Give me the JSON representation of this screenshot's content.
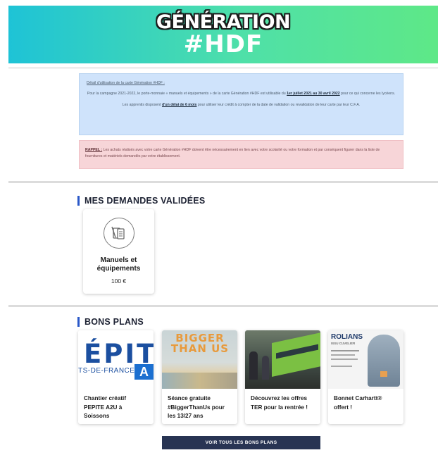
{
  "header": {
    "logo_line1": "GÉNÉRATION",
    "logo_line2": "#HDF",
    "gradient": [
      "#1ec3d6",
      "#5ee887"
    ]
  },
  "info": {
    "title": "Détail d'utilisation de la carte Génération #HDF :",
    "p1_prefix": "Pour la campagne 2021-2022, le porte-monnaie « manuels et équipements » de la carte Génération #HDF est utilisable du",
    "p1_dates": "1er juillet 2021 au 30 avril 2022",
    "p1_suffix": "pour ce qui concerne les lycéens.",
    "p2_prefix": "Les apprentis disposent",
    "p2_delay": "d'un délai de 6 mois",
    "p2_suffix": "pour utiliser leur crédit à compter de la date de validation ou revalidation de leur carte par leur C.F.A."
  },
  "warning": {
    "label": "RAPPEL :",
    "text": "Les achats réalisés avec votre carte Génération #HDF doivent être nécessairement en lien avec votre scolarité ou votre formation et par conséquent figurer dans la liste de fournitures et matériels demandés par votre établissement."
  },
  "validated": {
    "title": "MES DEMANDES VALIDÉES",
    "items": [
      {
        "label": "Manuels et équipements",
        "amount": "100 €",
        "icon": "books-icon"
      }
    ]
  },
  "bons_plans": {
    "title": "BONS PLANS",
    "cards": [
      {
        "title": "Chantier créatif PEPITE A2U à Soissons",
        "image_text": "ÉPIT",
        "image_sub": "TS-DE-FRANCE",
        "image_badge": "A"
      },
      {
        "title": "Séance gratuite #BiggerThanUs pour les 13/27 ans",
        "image_text": "BIGGER THAN US"
      },
      {
        "title": "Découvrez les offres TER pour la rentrée !"
      },
      {
        "title": "Bonnet Carhartt® offert !",
        "image_text": "ROLIANS",
        "image_sub": "ISSU CUVELIER"
      }
    ],
    "cta": "VOIR TOUS LES BONS PLANS"
  }
}
